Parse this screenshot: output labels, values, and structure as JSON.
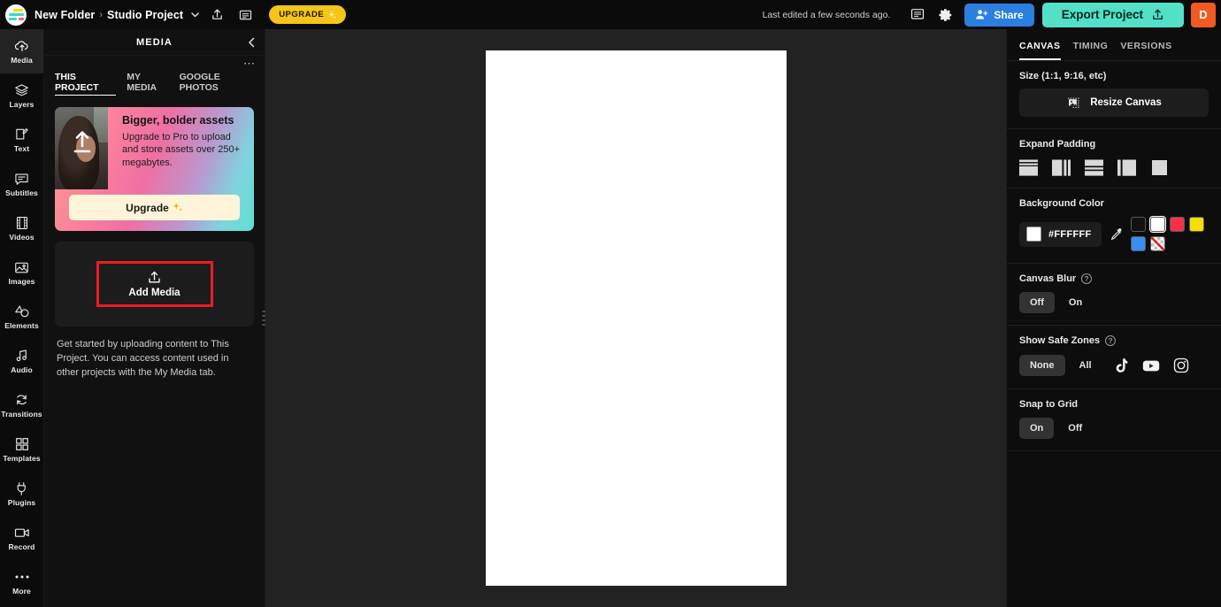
{
  "topbar": {
    "logo_name": "app-logo",
    "folder": "New Folder",
    "separator": "›",
    "project": "Studio Project",
    "project_chevron": "⌄",
    "share_export_icon": "share-upload-icon",
    "notes_icon": "comment-icon",
    "upgrade_label": "UPGRADE",
    "upgrade_sparkle": "✨",
    "last_edited": "Last edited a few seconds ago.",
    "settings_icon": "gear-icon",
    "share_label": "Share",
    "export_label": "Export Project",
    "avatar_initial": "D"
  },
  "rail": {
    "items": [
      {
        "label": "Media",
        "icon": "media-cloud-icon",
        "active": true
      },
      {
        "label": "Layers",
        "icon": "layers-icon",
        "active": false
      },
      {
        "label": "Text",
        "icon": "text-edit-icon",
        "active": false
      },
      {
        "label": "Subtitles",
        "icon": "subtitles-icon",
        "active": false
      },
      {
        "label": "Videos",
        "icon": "film-icon",
        "active": false
      },
      {
        "label": "Images",
        "icon": "image-icon",
        "active": false
      },
      {
        "label": "Elements",
        "icon": "elements-icon",
        "active": false
      },
      {
        "label": "Audio",
        "icon": "audio-note-icon",
        "active": false
      },
      {
        "label": "Transitions",
        "icon": "transitions-icon",
        "active": false
      },
      {
        "label": "Templates",
        "icon": "templates-grid-icon",
        "active": false
      },
      {
        "label": "Plugins",
        "icon": "plug-icon",
        "active": false
      },
      {
        "label": "Record",
        "icon": "record-camera-icon",
        "active": false
      },
      {
        "label": "More",
        "icon": "ellipsis-icon",
        "active": false
      }
    ]
  },
  "media_panel": {
    "title": "MEDIA",
    "collapse_icon": "chevron-left-icon",
    "overflow_icon": "ellipsis-icon",
    "tabs": [
      {
        "label": "THIS PROJECT",
        "active": true
      },
      {
        "label": "MY MEDIA",
        "active": false
      },
      {
        "label": "GOOGLE PHOTOS",
        "active": false
      }
    ],
    "promo": {
      "heading": "Bigger, bolder assets",
      "body": "Upgrade to Pro to upload and store assets over 250+ megabytes.",
      "button_label": "Upgrade",
      "button_sparkle": "✨",
      "thumb_icon": "upload-arrow-icon"
    },
    "dropzone": {
      "icon": "upload-icon",
      "label": "Add Media",
      "highlight_color": "#EE1C25"
    },
    "hint": "Get started by uploading content to This Project. You can access content used in other projects with the My Media tab.",
    "resize_grip": "panel-resize-grip"
  },
  "stage": {
    "canvas_color": "#FFFFFF",
    "background_color": "#222222"
  },
  "right_panel": {
    "tabs": [
      {
        "label": "CANVAS",
        "active": true
      },
      {
        "label": "TIMING",
        "active": false
      },
      {
        "label": "VERSIONS",
        "active": false
      }
    ],
    "size_section": {
      "title": "Size (1:1, 9:16, etc)",
      "resize_label": "Resize Canvas",
      "resize_icon": "resize-canvas-icon"
    },
    "padding_section": {
      "title": "Expand Padding",
      "options": [
        "pad-top-bottom-icon",
        "pad-left-right-icon",
        "pad-bottom-icon",
        "pad-left-icon",
        "pad-none-icon"
      ]
    },
    "background_section": {
      "title": "Background Color",
      "hex_value": "#FFFFFF",
      "eyedropper_icon": "eyedropper-icon",
      "swatches": [
        {
          "name": "swatch-black",
          "color": "#111111",
          "selected": false
        },
        {
          "name": "swatch-white",
          "color": "#FFFFFF",
          "selected": true
        },
        {
          "name": "swatch-red",
          "color": "#F6304B",
          "selected": false
        },
        {
          "name": "swatch-yellow",
          "color": "#F7DE00",
          "selected": false
        },
        {
          "name": "swatch-blue",
          "color": "#3A8EF0",
          "selected": false
        },
        {
          "name": "swatch-transparent",
          "color": "transparent",
          "selected": false
        }
      ]
    },
    "blur_section": {
      "title": "Canvas Blur",
      "help_icon": "help-icon",
      "options": [
        {
          "label": "Off",
          "selected": true
        },
        {
          "label": "On",
          "selected": false
        }
      ]
    },
    "safe_zones_section": {
      "title": "Show Safe Zones",
      "help_icon": "help-icon",
      "options": [
        {
          "label": "None",
          "selected": true
        },
        {
          "label": "All",
          "selected": false
        }
      ],
      "platforms": [
        {
          "name": "tiktok-icon"
        },
        {
          "name": "youtube-icon"
        },
        {
          "name": "instagram-icon"
        }
      ]
    },
    "snap_section": {
      "title": "Snap to Grid",
      "options": [
        {
          "label": "On",
          "selected": true
        },
        {
          "label": "Off",
          "selected": false
        }
      ]
    }
  }
}
